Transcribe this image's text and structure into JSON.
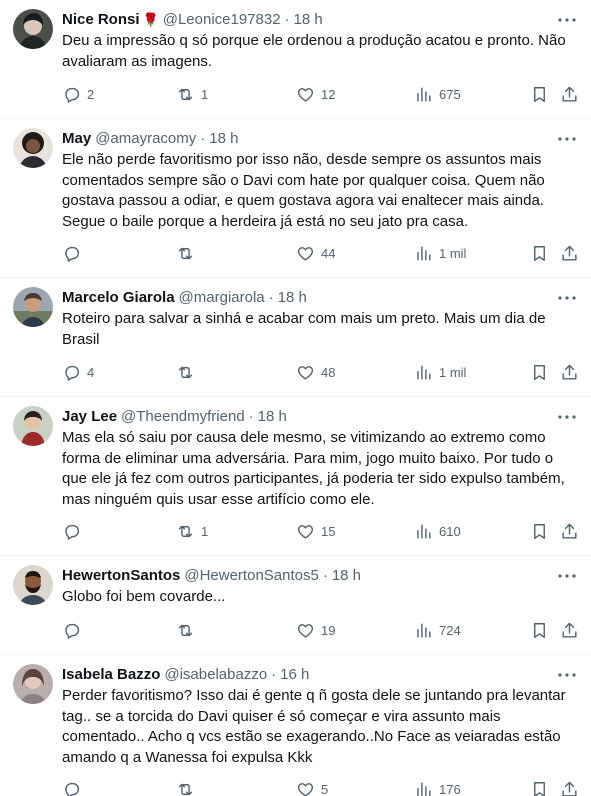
{
  "tweets": [
    {
      "name": "Nice Ronsi",
      "name_emoji": "🌹",
      "handle": "@Leonice197832",
      "time": "18 h",
      "text": "Deu a impressão q só porque ele ordenou a produção acatou e pronto. Não avaliaram as imagens.",
      "replies": "2",
      "retweets": "1",
      "likes": "12",
      "views": "675",
      "avatar_color": "#3a3f3a"
    },
    {
      "name": "May",
      "handle": "@amayracomy",
      "time": "18 h",
      "text": "Ele não perde favoritismo por isso não, desde sempre os assuntos mais comentados sempre são o Davi com hate por qualquer coisa. Quem não gostava passou a odiar, e quem gostava agora vai enaltecer mais ainda. Segue o baile porque a herdeira já está no seu jato pra casa.",
      "replies": "",
      "retweets": "",
      "likes": "44",
      "views": "1 mil",
      "avatar_color": "#2b1d1a"
    },
    {
      "name": "Marcelo Giarola",
      "handle": "@margiarola",
      "time": "18 h",
      "text": "Roteiro para salvar a sinhá e acabar com mais um preto. Mais um dia de Brasil",
      "replies": "4",
      "retweets": "",
      "likes": "48",
      "views": "1 mil",
      "avatar_color": "#7d8a95"
    },
    {
      "name": "Jay Lee",
      "handle": "@Theendmyfriend",
      "time": "18 h",
      "text": "Mas ela só saiu por causa dele mesmo, se vitimizando ao extremo como forma de eliminar uma adversária. Para mim, jogo muito baixo. Por tudo o que ele já fez com outros participantes, já poderia ter sido expulso também, mas ninguém quis usar esse artifício como ele.",
      "replies": "",
      "retweets": "1",
      "likes": "15",
      "views": "610",
      "avatar_color": "#8a2b2b"
    },
    {
      "name": "HewertonSantos",
      "handle": "@HewertonSantos5",
      "time": "18 h",
      "text": "Globo foi bem covarde...",
      "replies": "",
      "retweets": "",
      "likes": "19",
      "views": "724",
      "avatar_color": "#c9c2b8"
    },
    {
      "name": "Isabela Bazzo",
      "handle": "@isabelabazzo",
      "time": "16 h",
      "text": "Perder favoritismo? Isso dai é gente q ñ gosta dele se juntando pra levantar tag.. se a torcida do Davi quiser é só começar e vira assunto mais comentado.. Acho q vcs estão se exagerando..No Face as veiaradas estão amando q a Wanessa foi expulsa Kkk",
      "replies": "",
      "retweets": "",
      "likes": "5",
      "views": "176",
      "avatar_color": "#a89a96"
    }
  ]
}
